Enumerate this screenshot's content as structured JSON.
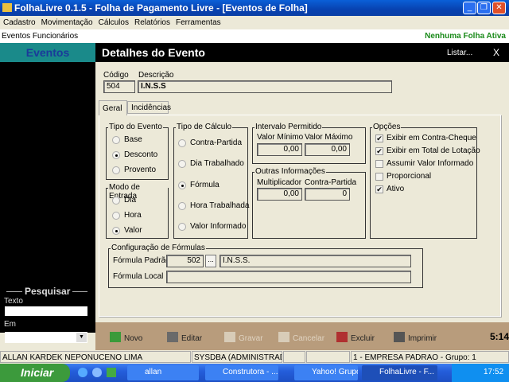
{
  "window": {
    "title": "FolhaLivre 0.1.5 - Folha de Pagamento Livre - [Eventos de Folha]"
  },
  "menu": [
    "Cadastro",
    "Movimentação",
    "Cálculos",
    "Relatórios",
    "Ferramentas"
  ],
  "toolbar": {
    "links": [
      "Eventos",
      "Funcionários"
    ],
    "status": "Nenhuma Folha Ativa",
    "status_color": "#1a8a1a"
  },
  "sidebar": {
    "title": "Eventos",
    "search_title": "Pesquisar",
    "texto_label": "Texto",
    "texto_value": "",
    "em_label": "Em",
    "em_value": ""
  },
  "header": {
    "title": "Detalhes do Evento",
    "list_label": "Listar...",
    "close_label": "X"
  },
  "form": {
    "codigo_label": "Código",
    "codigo": "504",
    "descricao_label": "Descrição",
    "descricao": "I.N.S.S",
    "tabs": [
      "Geral",
      "Incidências"
    ],
    "tipo_evento": {
      "label": "Tipo do Evento",
      "options": [
        "Base",
        "Desconto",
        "Provento"
      ],
      "selected": "Desconto"
    },
    "modo_entrada": {
      "label": "Modo de Entrada",
      "options": [
        "Dia",
        "Hora",
        "Valor"
      ],
      "selected": "Valor"
    },
    "tipo_calculo": {
      "label": "Tipo de Cálculo",
      "options": [
        "Contra-Partida",
        "Dia Trabalhado",
        "Fórmula",
        "Hora Trabalhada",
        "Valor Informado"
      ],
      "selected": "Fórmula"
    },
    "intervalo": {
      "label": "Intervalo Permitido",
      "min_label": "Valor Mínimo",
      "min": "0,00",
      "max_label": "Valor Máximo",
      "max": "0,00"
    },
    "outras": {
      "label": "Outras Informações",
      "mult_label": "Multiplicador",
      "mult": "0,00",
      "cp_label": "Contra-Partida",
      "cp": "0"
    },
    "opcoes": {
      "label": "Opções",
      "items": [
        {
          "label": "Exibir em Contra-Cheque",
          "checked": true
        },
        {
          "label": "Exibir em Total de Lotação",
          "checked": true
        },
        {
          "label": "Assumir Valor Informado",
          "checked": false
        },
        {
          "label": "Proporcional",
          "checked": false
        },
        {
          "label": "Ativo",
          "checked": true
        }
      ]
    },
    "formulas": {
      "label": "Configuração de Fórmulas",
      "padrao_label": "Fórmula Padrão",
      "padrao_code": "502",
      "browse": "...",
      "padrao_desc": "I.N.S.S.",
      "local_label": "Fórmula Local",
      "local": ""
    }
  },
  "actions": {
    "novo": "Novo",
    "editar": "Editar",
    "gravar": "Gravar",
    "cancelar": "Cancelar",
    "excluir": "Excluir",
    "imprimir": "Imprimir",
    "time": "5:14"
  },
  "statusbar": [
    "ALLAN KARDEK NEPONUCENO LIMA",
    "SYSDBA (ADMINISTRADOR)",
    "",
    "",
    "1 - EMPRESA PADRAO - Grupo: 1"
  ],
  "taskbar": {
    "start": "Iniciar",
    "items": [
      "allan",
      "Construtora - ...",
      "Yahoo! Grupo...",
      "FolhaLivre - F..."
    ],
    "clock": "17:52"
  }
}
